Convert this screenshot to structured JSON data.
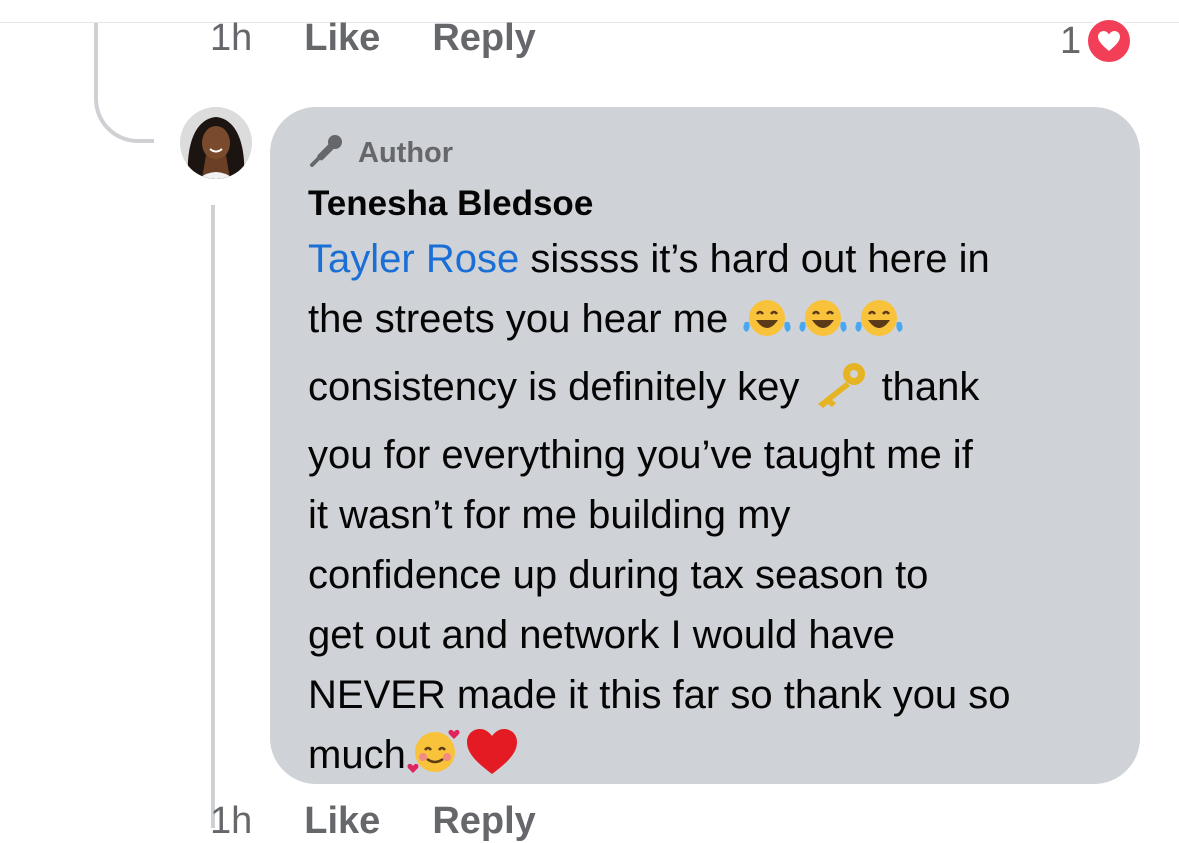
{
  "top_actions": {
    "time": "1h",
    "like": "Like",
    "reply": "Reply",
    "reaction_count": "1"
  },
  "comment": {
    "badge": "Author",
    "author_name": "Tenesha Bledsoe",
    "mention": "Tayler Rose",
    "lines": [
      " sissss it’s hard out here in",
      "the streets you hear me",
      "consistency is definitely key ",
      " thank",
      "you for everything you’ve taught me if",
      "it wasn’t for me building my",
      "confidence up during tax season to",
      "get out and network I would have",
      "NEVER made it this far so thank you so",
      "much"
    ],
    "emojis": [
      "tears-of-joy",
      "tears-of-joy",
      "tears-of-joy",
      "key",
      "smiling-face-with-hearts",
      "red-heart"
    ]
  },
  "bottom_actions": {
    "time": "1h",
    "like": "Like",
    "reply": "Reply"
  },
  "colors": {
    "bubble": "#cfd2d6",
    "mention": "#1a6fd6",
    "reaction": "#f33e58",
    "meta": "#65676b"
  }
}
